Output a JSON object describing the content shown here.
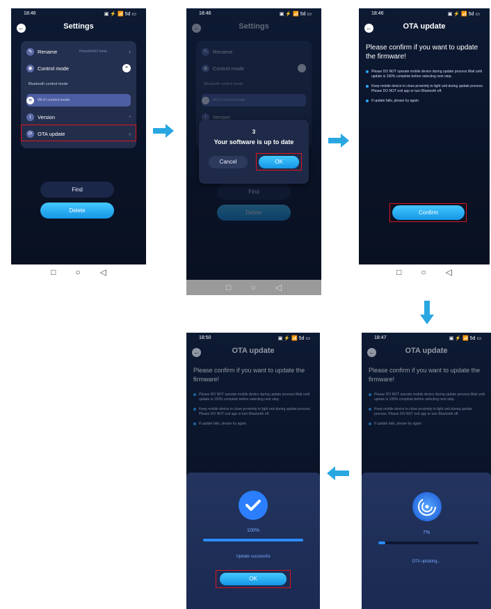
{
  "arrows": {
    "color": "#29a7e1"
  },
  "accent": {
    "blue": "#29b6ff",
    "red_highlight": "#e0141c"
  },
  "screen1": {
    "time": "18:46",
    "status_icons": "▣ ⚡ 📶 5d ▭",
    "title": "Settings",
    "back_icon": "←",
    "items": [
      {
        "label": "Rename",
        "hint": "Household's lamp",
        "icon": "rename-icon"
      },
      {
        "label": "Control mode",
        "icon": "control-mode-icon"
      },
      {
        "label": "Bluetooth control mode",
        "icon": "bluetooth-icon"
      },
      {
        "label": "Wi-Fi control mode",
        "icon": "wifi-icon"
      },
      {
        "label": "Version",
        "icon": "version-icon"
      },
      {
        "label": "OTA update",
        "icon": "ota-icon"
      }
    ],
    "find_label": "Find",
    "delete_label": "Delete"
  },
  "screen2": {
    "time": "18:46",
    "title": "Settings",
    "dialog_number": "3",
    "dialog_message": "Your software is up to date",
    "cancel_label": "Cancel",
    "ok_label": "OK",
    "find_label": "Find",
    "delete_label": "Delete"
  },
  "screen3": {
    "time": "18:46",
    "title": "OTA update",
    "heading": "Please confirm if you want to update the firmware!",
    "bullets": [
      "Please DO NOT operate mobile device during update process.Wait until update is 100% complete before selecting next step.",
      "Keep mobile device in close proximity to light unit during update process. Please DO NOT exit app or turn Bluetooth off.",
      "If update fails, please try again."
    ],
    "confirm_label": "Confirm"
  },
  "screen4": {
    "time": "18:47",
    "title": "OTA update",
    "heading": "Please confirm if you want to update the firmware!",
    "progress_text": "7%",
    "progress_value": 0.07,
    "status_text": "OTA updating..."
  },
  "screen5": {
    "time": "18:50",
    "title": "OTA update",
    "heading": "Please confirm if you want to update the firmware!",
    "progress_text": "100%",
    "progress_value": 1.0,
    "status_text": "Update successful",
    "ok_label": "OK"
  },
  "nav": {
    "square": "□",
    "circle": "○",
    "back": "◁"
  }
}
